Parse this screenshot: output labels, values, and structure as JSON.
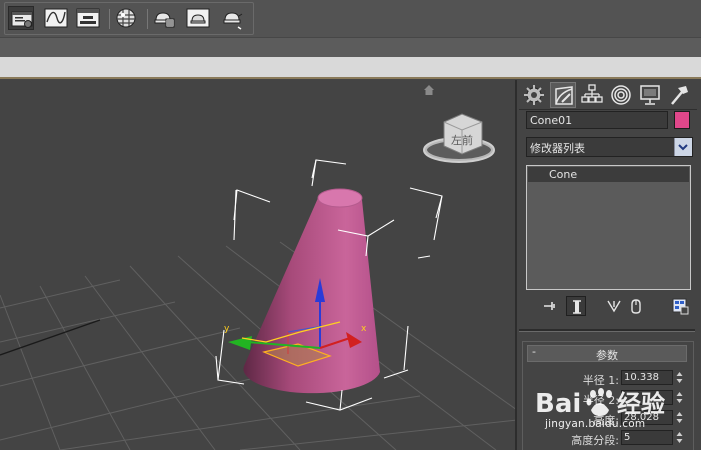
{
  "toolbar": {
    "buttons": [
      {
        "name": "scene-explorer-icon",
        "active": true
      },
      {
        "name": "curve-editor-icon",
        "active": false
      },
      {
        "name": "schematic-view-icon",
        "active": false
      },
      {
        "name": "material-editor-icon",
        "active": false
      },
      {
        "name": "render-setup-icon",
        "active": false
      },
      {
        "name": "rendered-frame-icon",
        "active": false
      },
      {
        "name": "render-teapot-icon",
        "active": false
      }
    ]
  },
  "viewcube": {
    "face_label": "左前"
  },
  "gizmo": {
    "x_label": "x",
    "y_label": "y"
  },
  "command_panel": {
    "tabs": [
      {
        "name": "create-tab-icon",
        "active": false
      },
      {
        "name": "modify-tab-icon",
        "active": true
      },
      {
        "name": "hierarchy-tab-icon",
        "active": false
      },
      {
        "name": "motion-tab-icon",
        "active": false
      },
      {
        "name": "display-tab-icon",
        "active": false
      },
      {
        "name": "utilities-tab-icon",
        "active": false
      }
    ],
    "object_name": "Cone01",
    "object_color": "#e0478a",
    "modifier_list_label": "修改器列表",
    "stack": [
      {
        "label": "Cone"
      }
    ],
    "stack_tools": [
      {
        "name": "pin-stack-icon"
      },
      {
        "name": "show-end-result-icon"
      },
      {
        "name": "make-unique-icon"
      },
      {
        "name": "remove-modifier-icon"
      },
      {
        "name": "configure-modifier-sets-icon"
      }
    ]
  },
  "parameters": {
    "collapse_symbol": "-",
    "title": "参数",
    "rows": [
      {
        "label": "半径 1:",
        "value": "10.338"
      },
      {
        "label": "半径 2:",
        "value": ""
      },
      {
        "label": "高度:",
        "value": "28.028"
      },
      {
        "label": "高度分段:",
        "value": "5"
      }
    ]
  },
  "watermark": {
    "logo_text": "Bai 经验",
    "url": "jingyan.baidu.com"
  },
  "colors": {
    "cone": "#c05a8c",
    "background": "#444444",
    "selection_bracket": "#ffffff",
    "axis_x": "#d22020",
    "axis_y": "#22b422",
    "axis_z": "#2a3bd8"
  }
}
